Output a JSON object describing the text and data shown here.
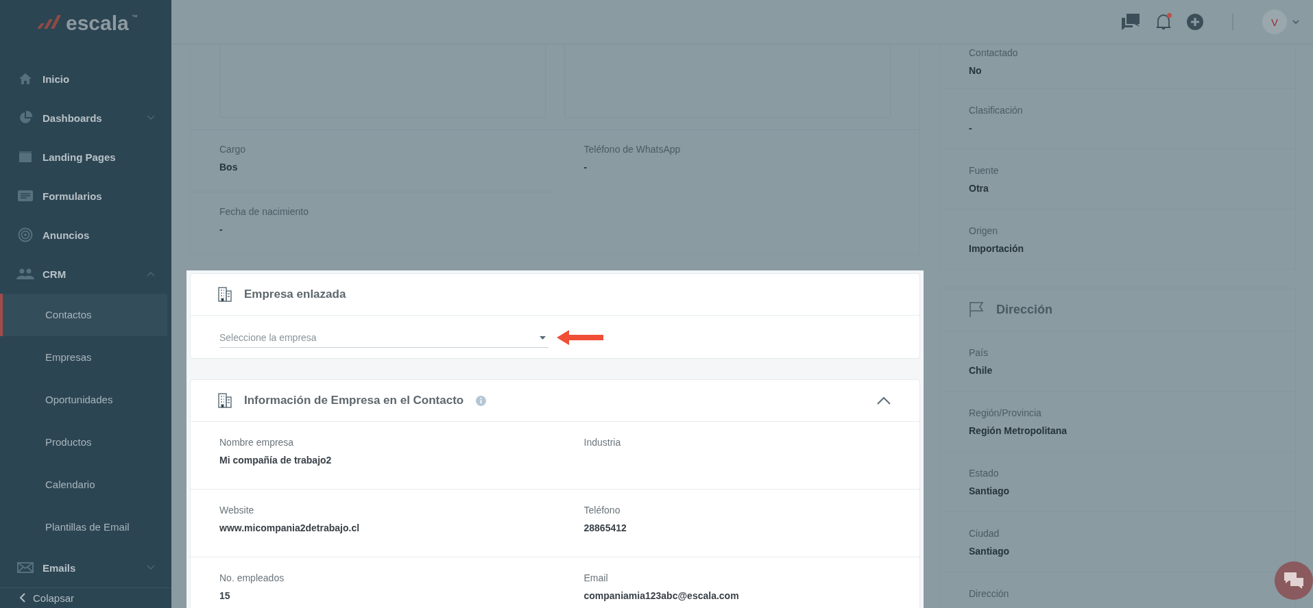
{
  "sidebar": {
    "logo_text": "escala",
    "logo_mark": "™",
    "items": [
      {
        "label": "Inicio"
      },
      {
        "label": "Dashboards",
        "expanded": false
      },
      {
        "label": "Landing Pages"
      },
      {
        "label": "Formularios"
      },
      {
        "label": "Anuncios"
      },
      {
        "label": "CRM",
        "expanded": true,
        "children": [
          {
            "label": "Contactos",
            "selected": true
          },
          {
            "label": "Empresas",
            "selected": false
          },
          {
            "label": "Oportunidades",
            "selected": false
          },
          {
            "label": "Productos",
            "selected": false
          },
          {
            "label": "Calendario",
            "selected": false
          },
          {
            "label": "Plantillas de Email",
            "selected": false
          }
        ]
      },
      {
        "label": "Emails",
        "expanded": false
      }
    ],
    "collapse": "Colapsar"
  },
  "topbar": {
    "has_notification": true,
    "avatar": "V"
  },
  "contact_card": {
    "fields": [
      {
        "label": "Cargo",
        "value": "Bos"
      },
      {
        "label": "Teléfono de WhatsApp",
        "value": "-"
      },
      {
        "label": "Fecha de nacimiento",
        "value": "-"
      }
    ]
  },
  "linked_company": {
    "title": "Empresa enlazada",
    "select": {
      "placeholder": "Seleccione la empresa"
    }
  },
  "company_info": {
    "title": "Información de Empresa en el Contacto",
    "expanded": true,
    "fields": [
      {
        "label": "Nombre empresa",
        "value": "Mi compañía de trabajo2"
      },
      {
        "label": "Industria"
      },
      {
        "label": "Website",
        "value": "www.micompania2detrabajo.cl"
      },
      {
        "label": "Teléfono",
        "value": "28865412"
      },
      {
        "label": "No. empleados",
        "value": "15"
      },
      {
        "label": "Email",
        "value": "companiamia123abc@escala.com"
      }
    ]
  },
  "details": {
    "fields": [
      {
        "label": "Contactado",
        "value": "No"
      },
      {
        "label": "Clasificación",
        "value": "-"
      },
      {
        "label": "Fuente",
        "value": "Otra"
      },
      {
        "label": "Origen",
        "value": "Importación"
      }
    ]
  },
  "address": {
    "title": "Dirección",
    "fields": [
      {
        "label": "País",
        "value": "Chile"
      },
      {
        "label": "Región/Provincia",
        "value": "Región Metropolitana"
      },
      {
        "label": "Estado",
        "value": "Santiago"
      },
      {
        "label": "Ciudad",
        "value": "Santiago"
      },
      {
        "label": "Dirección"
      }
    ]
  }
}
